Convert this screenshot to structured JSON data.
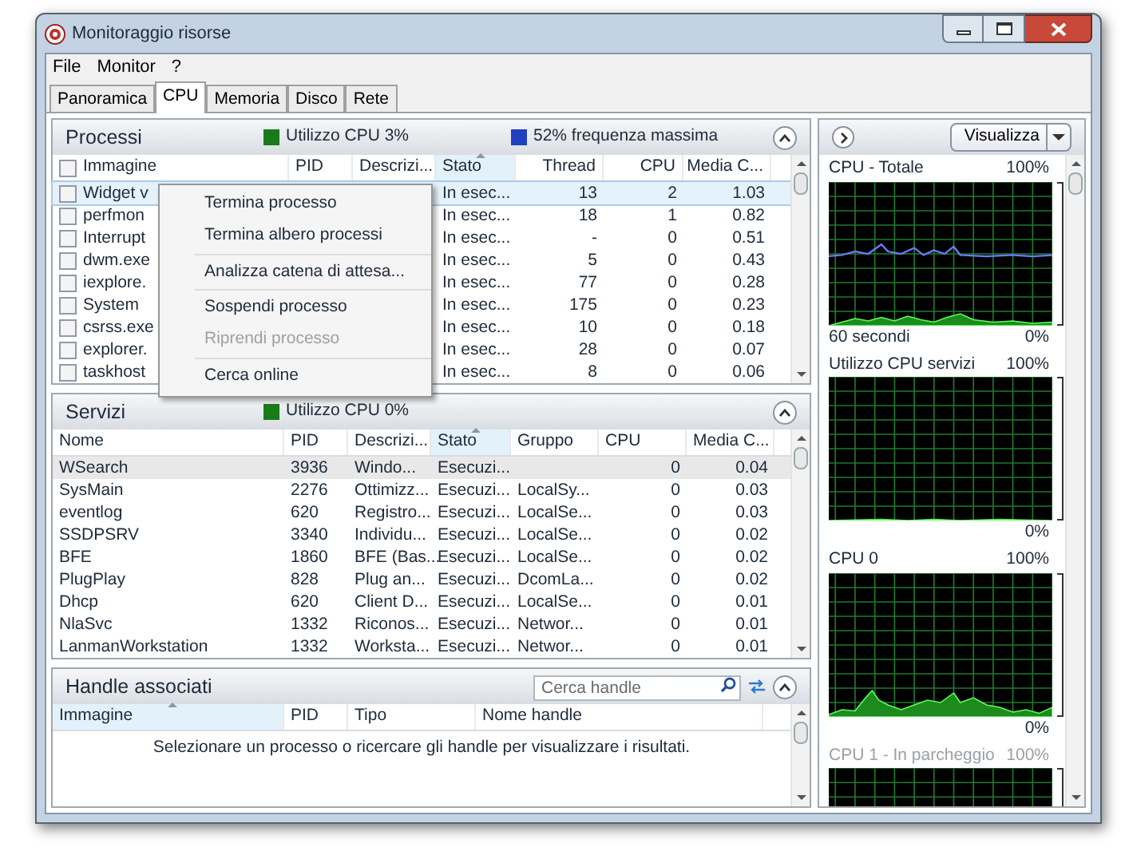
{
  "window": {
    "title": "Monitoraggio risorse"
  },
  "menu": [
    "File",
    "Monitor",
    "?"
  ],
  "tabs": [
    {
      "label": "Panoramica",
      "selected": false
    },
    {
      "label": "CPU",
      "selected": true
    },
    {
      "label": "Memoria",
      "selected": false
    },
    {
      "label": "Disco",
      "selected": false
    },
    {
      "label": "Rete",
      "selected": false
    }
  ],
  "processes": {
    "title": "Processi",
    "legend": [
      {
        "label": "Utilizzo CPU 3%",
        "color": "#1a7a1a"
      },
      {
        "label": "52% frequenza massima",
        "color": "#2040c0"
      }
    ],
    "columns": [
      {
        "label": "Immagine",
        "sorted": false
      },
      {
        "label": "PID",
        "sorted": false
      },
      {
        "label": "Descrizi...",
        "sorted": false
      },
      {
        "label": "Stato",
        "sorted": true
      },
      {
        "label": "Thread",
        "sorted": false
      },
      {
        "label": "CPU",
        "sorted": false
      },
      {
        "label": "Media C...",
        "sorted": false
      }
    ],
    "rows": [
      {
        "image": "Widget v",
        "status": "In esec...",
        "threads": "13",
        "cpu": "2",
        "avg": "1.03",
        "checked": false,
        "selected": true
      },
      {
        "image": "perfmon",
        "status": "In esec...",
        "threads": "18",
        "cpu": "1",
        "avg": "0.82",
        "checked": false,
        "selected": false
      },
      {
        "image": "Interrupt",
        "status": "In esec...",
        "threads": "-",
        "cpu": "0",
        "avg": "0.51",
        "checked": false,
        "selected": false
      },
      {
        "image": "dwm.exe",
        "status": "In esec...",
        "threads": "5",
        "cpu": "0",
        "avg": "0.43",
        "checked": false,
        "selected": false
      },
      {
        "image": "iexplore.",
        "status": "In esec...",
        "threads": "77",
        "cpu": "0",
        "avg": "0.28",
        "checked": false,
        "selected": false
      },
      {
        "image": "System",
        "status": "In esec...",
        "threads": "175",
        "cpu": "0",
        "avg": "0.23",
        "checked": false,
        "selected": false
      },
      {
        "image": "csrss.exe",
        "status": "In esec...",
        "threads": "10",
        "cpu": "0",
        "avg": "0.18",
        "checked": false,
        "selected": false
      },
      {
        "image": "explorer.",
        "status": "In esec...",
        "threads": "28",
        "cpu": "0",
        "avg": "0.07",
        "checked": false,
        "selected": false
      },
      {
        "image": "taskhost",
        "status": "In esec...",
        "threads": "8",
        "cpu": "0",
        "avg": "0.06",
        "checked": false,
        "selected": false
      }
    ]
  },
  "context_menu": {
    "groups": [
      [
        {
          "label": "Termina processo",
          "disabled": false
        },
        {
          "label": "Termina albero processi",
          "disabled": false
        }
      ],
      [
        {
          "label": "Analizza catena di attesa...",
          "disabled": false
        }
      ],
      [
        {
          "label": "Sospendi processo",
          "disabled": false
        },
        {
          "label": "Riprendi processo",
          "disabled": true
        }
      ],
      [
        {
          "label": "Cerca online",
          "disabled": false
        }
      ]
    ]
  },
  "services": {
    "title": "Servizi",
    "legend": [
      {
        "label": "Utilizzo CPU 0%",
        "color": "#1a7a1a"
      }
    ],
    "columns": [
      {
        "label": "Nome",
        "sorted": false
      },
      {
        "label": "PID",
        "sorted": false
      },
      {
        "label": "Descrizi...",
        "sorted": false
      },
      {
        "label": "Stato",
        "sorted": true
      },
      {
        "label": "Gruppo",
        "sorted": false
      },
      {
        "label": "CPU",
        "sorted": false
      },
      {
        "label": "Media C...",
        "sorted": false
      }
    ],
    "rows": [
      {
        "cells": [
          "WSearch",
          "3936",
          "Windo...",
          "Esecuzi...",
          "",
          "0",
          "0.04"
        ],
        "selected": true
      },
      {
        "cells": [
          "SysMain",
          "2276",
          "Ottimizz...",
          "Esecuzi...",
          "LocalSy...",
          "0",
          "0.03"
        ],
        "selected": false
      },
      {
        "cells": [
          "eventlog",
          "620",
          "Registro...",
          "Esecuzi...",
          "LocalSe...",
          "0",
          "0.03"
        ],
        "selected": false
      },
      {
        "cells": [
          "SSDPSRV",
          "3340",
          "Individu...",
          "Esecuzi...",
          "LocalSe...",
          "0",
          "0.02"
        ],
        "selected": false
      },
      {
        "cells": [
          "BFE",
          "1860",
          "BFE (Bas...",
          "Esecuzi...",
          "LocalSe...",
          "0",
          "0.02"
        ],
        "selected": false
      },
      {
        "cells": [
          "PlugPlay",
          "828",
          "Plug an...",
          "Esecuzi...",
          "DcomLa...",
          "0",
          "0.02"
        ],
        "selected": false
      },
      {
        "cells": [
          "Dhcp",
          "620",
          "Client D...",
          "Esecuzi...",
          "LocalSe...",
          "0",
          "0.01"
        ],
        "selected": false
      },
      {
        "cells": [
          "NlaSvc",
          "1332",
          "Riconos...",
          "Esecuzi...",
          "Networ...",
          "0",
          "0.01"
        ],
        "selected": false
      },
      {
        "cells": [
          "LanmanWorkstation",
          "1332",
          "Worksta...",
          "Esecuzi...",
          "Networ...",
          "0",
          "0.01"
        ],
        "selected": false
      }
    ]
  },
  "handles": {
    "title": "Handle associati",
    "search": {
      "placeholder": "Cerca handle"
    },
    "columns": [
      {
        "label": "Immagine",
        "sorted": true
      },
      {
        "label": "PID",
        "sorted": false
      },
      {
        "label": "Tipo",
        "sorted": false
      },
      {
        "label": "Nome handle",
        "sorted": false
      }
    ],
    "message": "Selezionare un processo o ricercare gli handle per visualizzare i risultati."
  },
  "graphs_panel": {
    "view_button": "Visualizza",
    "graphs": [
      {
        "title": "CPU - Totale",
        "max": "100%",
        "min": "0%",
        "footer": "60 secondi",
        "dimmed": false
      },
      {
        "title": "Utilizzo CPU servizi",
        "max": "100%",
        "min": "0%",
        "dimmed": false
      },
      {
        "title": "CPU 0",
        "max": "100%",
        "min": "0%",
        "dimmed": false
      },
      {
        "title": "CPU 1 - In parcheggio",
        "max": "100%",
        "dimmed": true
      }
    ]
  }
}
